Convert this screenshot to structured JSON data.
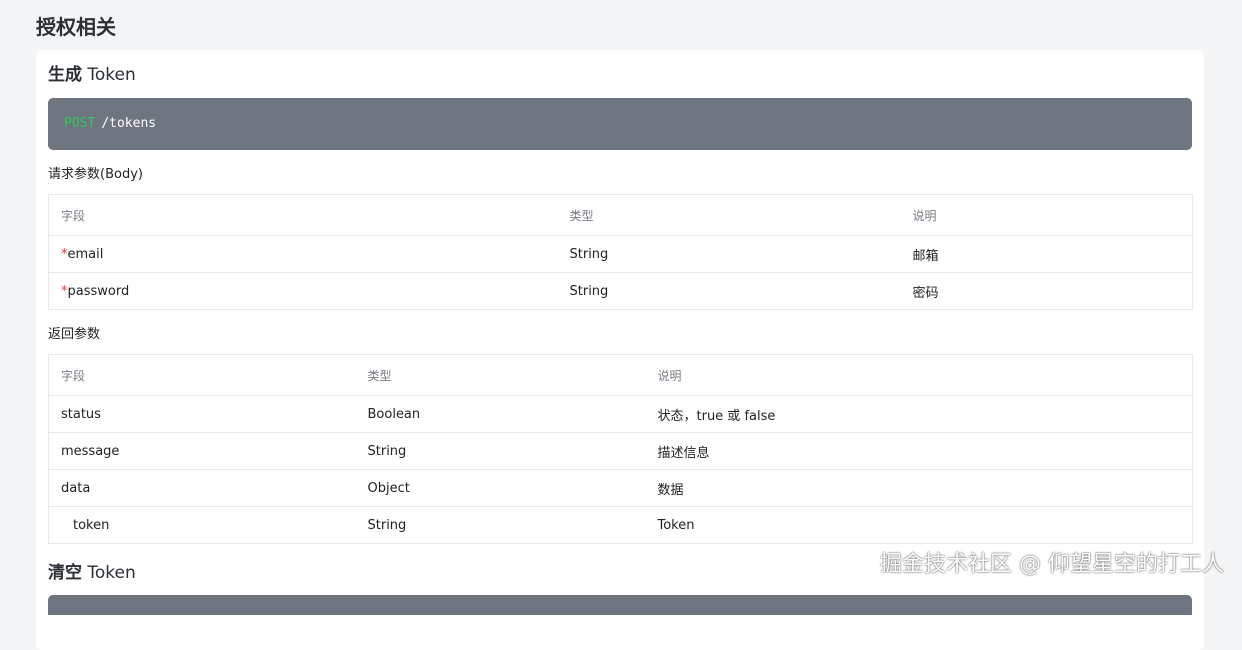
{
  "page": {
    "title": "授权相关"
  },
  "sections": [
    {
      "title_cn": "生成",
      "title_en": "Token",
      "method": "POST",
      "path": "/tokens",
      "request": {
        "heading": "请求参数(Body)",
        "columns": [
          "字段",
          "类型",
          "说明"
        ],
        "rows": [
          {
            "required_mark": "*",
            "field": "email",
            "type": "String",
            "desc": "邮箱"
          },
          {
            "required_mark": "*",
            "field": "password",
            "type": "String",
            "desc": "密码"
          }
        ]
      },
      "response": {
        "heading": "返回参数",
        "columns": [
          "字段",
          "类型",
          "说明"
        ],
        "rows": [
          {
            "field": "status",
            "type": "Boolean",
            "desc": "状态，true 或 false"
          },
          {
            "field": "message",
            "type": "String",
            "desc": "描述信息"
          },
          {
            "field": "data",
            "type": "Object",
            "desc": "数据"
          },
          {
            "field": "token",
            "type": "String",
            "desc": "Token"
          }
        ]
      }
    },
    {
      "title_cn": "清空",
      "title_en": "Token"
    }
  ],
  "watermark": "掘金技术社区 @ 仰望星空的打工人",
  "colors": {
    "background": "#f4f5f7",
    "endpoint_bg": "#6e7480",
    "method_post": "#34c759",
    "required": "#e53935"
  }
}
